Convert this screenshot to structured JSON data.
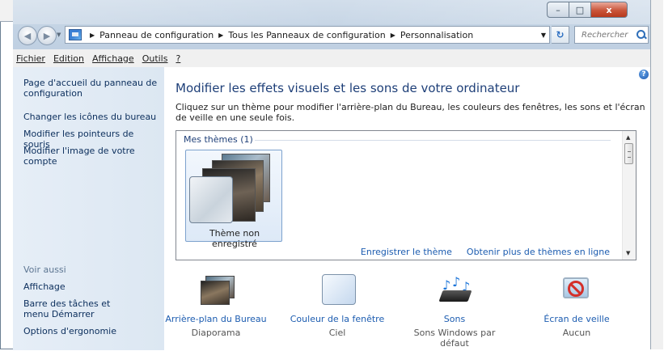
{
  "window": {
    "caption_buttons": {
      "minimize": "–",
      "maximize": "□",
      "close": "x"
    }
  },
  "address_bar": {
    "crumbs": [
      "Panneau de configuration",
      "Tous les Panneaux de configuration",
      "Personnalisation"
    ],
    "search_placeholder": "Rechercher"
  },
  "menu": [
    "Fichier",
    "Edition",
    "Affichage",
    "Outils",
    "?"
  ],
  "sidebar": {
    "links": [
      "Page d'accueil du panneau de configuration",
      "Changer les icônes du bureau",
      "Modifier les pointeurs de souris",
      "Modifier l'image de votre compte"
    ],
    "see_also_heading": "Voir aussi",
    "see_also": [
      "Affichage",
      "Barre des tâches et menu Démarrer",
      "Options d'ergonomie"
    ]
  },
  "main": {
    "title": "Modifier les effets visuels et les sons de votre ordinateur",
    "description": "Cliquez sur un thème pour modifier l'arrière-plan du Bureau, les couleurs des fenêtres, les sons et l'écran de veille en une seule fois.",
    "themes_group": "Mes thèmes (1)",
    "theme_tile_label": "Thème non enregistré",
    "save_theme_link": "Enregistrer le thème",
    "more_themes_link": "Obtenir plus de thèmes en ligne",
    "bottom_items": [
      {
        "label": "Arrière-plan du Bureau",
        "value": "Diaporama",
        "icon": "desktop-background-icon"
      },
      {
        "label": "Couleur de la fenêtre",
        "value": "Ciel",
        "icon": "window-color-icon"
      },
      {
        "label": "Sons",
        "value": "Sons Windows par défaut",
        "icon": "sounds-icon"
      },
      {
        "label": "Écran de veille",
        "value": "Aucun",
        "icon": "screensaver-icon"
      }
    ]
  },
  "colors": {
    "title_blue": "#1e3f78",
    "link_blue": "#1c5cb0",
    "sidebar_bg": "#dce7f2"
  }
}
